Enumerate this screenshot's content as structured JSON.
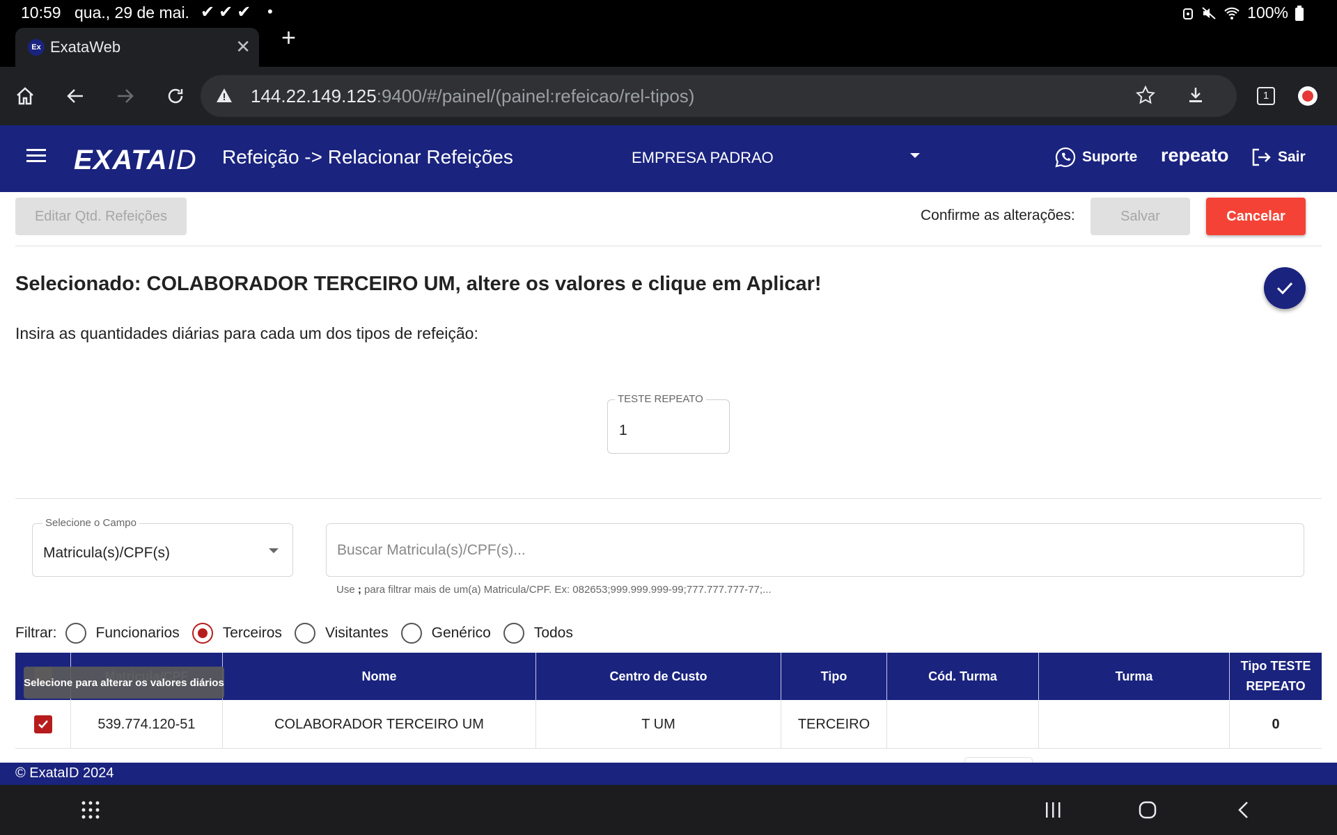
{
  "status_bar": {
    "time": "10:59",
    "date": "qua., 29 de mai.",
    "notification_checks": "✔✔✔",
    "battery": "100%"
  },
  "browser": {
    "tab_title": "ExataWeb",
    "favicon_text": "Ex",
    "url_host": "144.22.149.125",
    "url_rest": ":9400/#/painel/(painel:refeicao/rel-tipos)",
    "tab_count": "1"
  },
  "header": {
    "logo_main": "EXATA",
    "logo_id": "ID",
    "title": "Refeição -> Relacionar Refeições",
    "company": "EMPRESA PADRAO",
    "support_label": "Suporte",
    "username": "repeato",
    "logout_label": "Sair"
  },
  "actions": {
    "edit_qty_label": "Editar Qtd. Refeições",
    "confirm_label": "Confirme as alterações:",
    "save_label": "Salvar",
    "cancel_label": "Cancelar"
  },
  "selection": {
    "title": "Selecionado: COLABORADOR TERCEIRO UM, altere os valores e clique em Aplicar!",
    "instructions": "Insira as quantidades diárias para cada um dos tipos de refeição:",
    "qty_field_label": "TESTE REPEATO",
    "qty_field_value": "1"
  },
  "filters": {
    "field_select_label": "Selecione o Campo",
    "field_select_value": "Matricula(s)/CPF(s)",
    "search_placeholder": "Buscar Matricula(s)/CPF(s)...",
    "hint_prefix": "Use",
    "hint_separator": ";",
    "hint_suffix": "para filtrar mais de um(a) Matricula/CPF. Ex: 082653;999.999.999-99;777.777.777-77;...",
    "filter_label": "Filtrar:",
    "radio_options": [
      "Funcionarios",
      "Terceiros",
      "Visitantes",
      "Genérico",
      "Todos"
    ],
    "selected_option": "Terceiros"
  },
  "table": {
    "tooltip": "Selecione para alterar os valores diários",
    "columns": [
      "",
      "Matricula/CPF",
      "Nome",
      "Centro de Custo",
      "Tipo",
      "Cód. Turma",
      "Turma",
      "Tipo TESTE REPEATO"
    ],
    "rows": [
      {
        "checked": true,
        "cpf": "539.774.120-51",
        "nome": "COLABORADOR TERCEIRO UM",
        "centro_custo": "T UM",
        "tipo": "TERCEIRO",
        "cod_turma": "",
        "turma": "",
        "tipo_teste": "0"
      }
    ]
  },
  "footer": {
    "copyright": "© ExataID 2024"
  },
  "colors": {
    "primary": "#1a237e",
    "danger": "#f44336",
    "accent_radio": "#b71c1c"
  }
}
